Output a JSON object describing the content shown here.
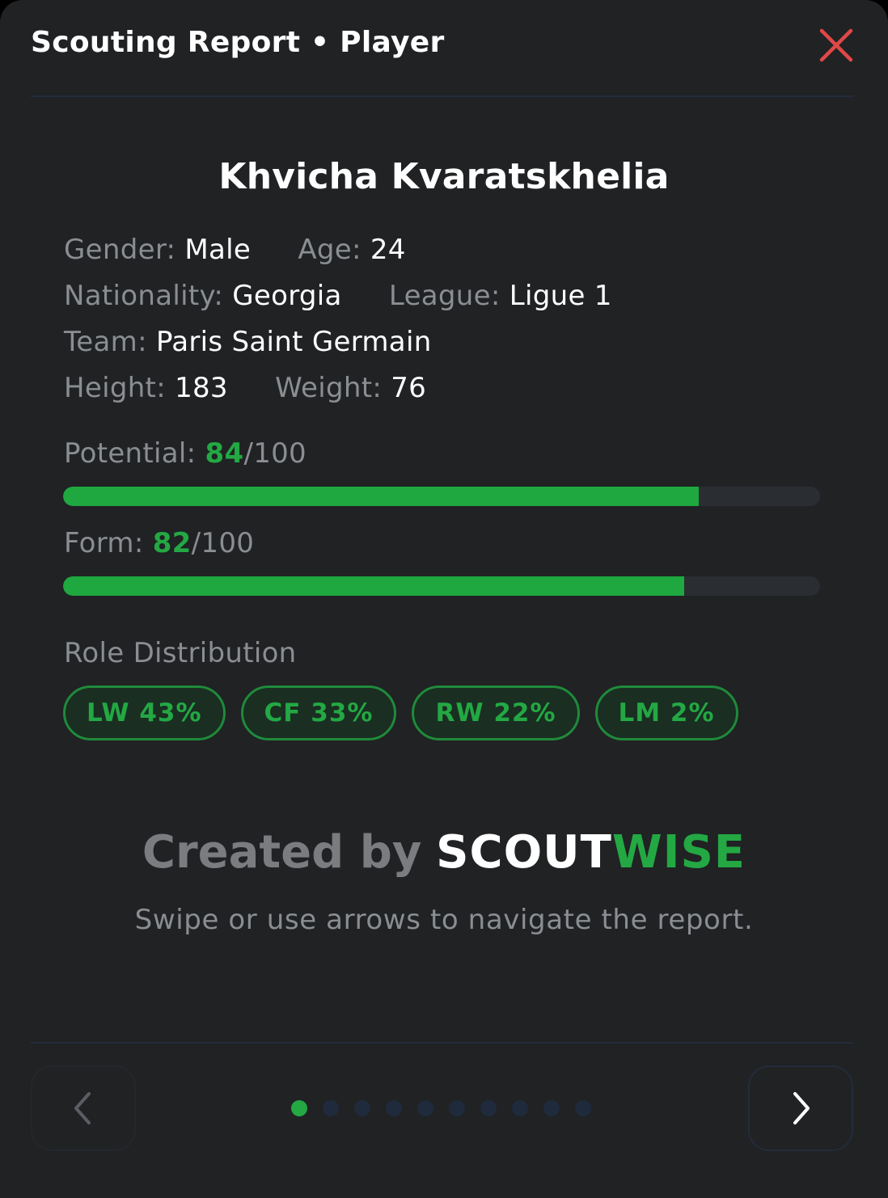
{
  "header": {
    "title": "Scouting Report • Player"
  },
  "player": {
    "name": "Khvicha Kvaratskhelia",
    "rows": [
      [
        {
          "label": "Gender:",
          "value": "Male"
        },
        {
          "label": "Age:",
          "value": "24"
        }
      ],
      [
        {
          "label": "Nationality:",
          "value": "Georgia"
        },
        {
          "label": "League:",
          "value": "Ligue 1"
        }
      ],
      [
        {
          "label": "Team:",
          "value": "Paris Saint Germain"
        }
      ],
      [
        {
          "label": "Height:",
          "value": "183"
        },
        {
          "label": "Weight:",
          "value": "76"
        }
      ]
    ]
  },
  "metrics": {
    "potential": {
      "label": "Potential:",
      "score": "84",
      "max": "/100",
      "fraction": 0.84
    },
    "form": {
      "label": "Form:",
      "score": "82",
      "max": "/100",
      "fraction": 0.82
    }
  },
  "roles": {
    "title": "Role Distribution",
    "chips": [
      "LW 43%",
      "CF 33%",
      "RW 22%",
      "LM 2%"
    ]
  },
  "credit": {
    "prefix": "Created by",
    "brand_a": "SCOUT",
    "brand_b": "WISE"
  },
  "hint": "Swipe or use arrows to navigate the report.",
  "pager": {
    "total": 10,
    "active": 0
  },
  "colors": {
    "accent": "#23a843",
    "close": "#e04848",
    "background": "#202224"
  }
}
